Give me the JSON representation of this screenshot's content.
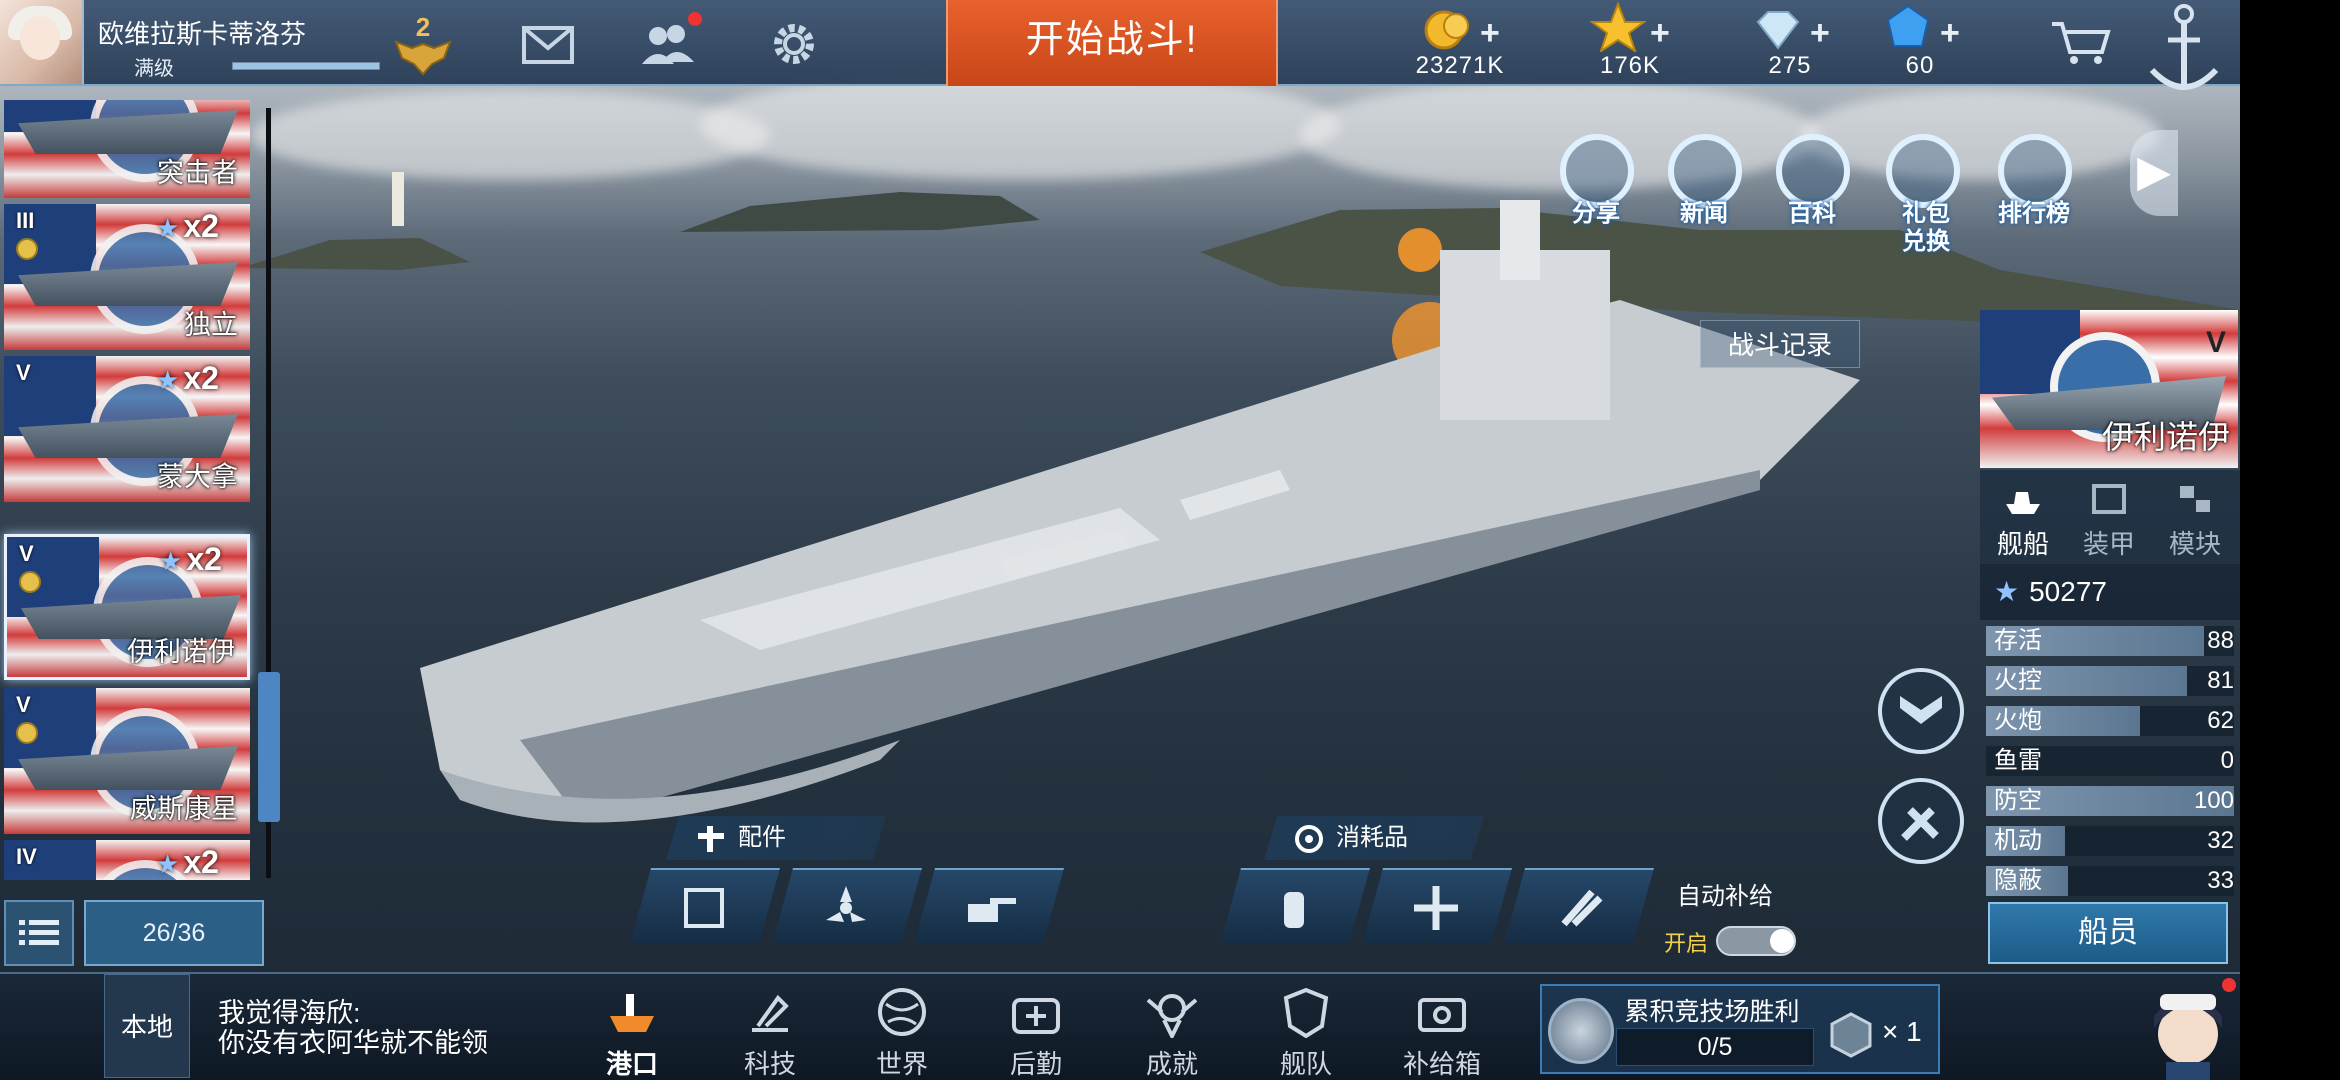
{
  "player": {
    "name": "欧维拉斯卡蒂洛芬",
    "level_label": "满级",
    "xp_fraction": 1.0,
    "rank": "2"
  },
  "top": {
    "start_battle_label": "开始战斗!",
    "resources": [
      {
        "icon": "gold-coin-icon",
        "value": "23271K"
      },
      {
        "icon": "star-icon",
        "value": "176K"
      },
      {
        "icon": "diamond-icon",
        "value": "275"
      },
      {
        "icon": "blue-crystal-icon",
        "value": "60"
      }
    ]
  },
  "quick_menu": [
    {
      "icon": "share-icon",
      "label": "分享"
    },
    {
      "icon": "news-icon",
      "label": "新闻"
    },
    {
      "icon": "encyclopedia-icon",
      "label": "百科"
    },
    {
      "icon": "gift-redeem-icon",
      "label": "礼包兑换"
    },
    {
      "icon": "leaderboard-icon",
      "label": "排行榜"
    }
  ],
  "battle_record_label": "战斗记录",
  "ship_list": [
    {
      "name": "突击者",
      "tier": "",
      "multiplier": ""
    },
    {
      "name": "独立",
      "tier": "III",
      "multiplier": "x2"
    },
    {
      "name": "蒙大拿",
      "tier": "V",
      "multiplier": "x2"
    },
    {
      "name": "伊利诺伊",
      "tier": "V",
      "multiplier": "x2"
    },
    {
      "name": "威斯康星",
      "tier": "V",
      "multiplier": ""
    },
    {
      "name": "",
      "tier": "IV",
      "multiplier": "x2"
    }
  ],
  "ship_count": "26/36",
  "selected_ship": {
    "name": "伊利诺伊",
    "tier": "V",
    "tabs": [
      "舰船",
      "装甲",
      "模块"
    ],
    "power": "50277",
    "stats": [
      {
        "label": "存活",
        "value": 88
      },
      {
        "label": "火控",
        "value": 81
      },
      {
        "label": "火炮",
        "value": 62
      },
      {
        "label": "鱼雷",
        "value": 0
      },
      {
        "label": "防空",
        "value": 100
      },
      {
        "label": "机动",
        "value": 32
      },
      {
        "label": "隐蔽",
        "value": 33
      }
    ],
    "crew_label": "船员"
  },
  "equipment": {
    "parts_label": "配件",
    "consumables_label": "消耗品",
    "auto_supply_label": "自动补给",
    "auto_supply_state": "开启"
  },
  "chat": {
    "channel": "本地",
    "message_line1": "我觉得海欣:",
    "message_line2": "你没有衣阿华就不能领"
  },
  "nav": [
    {
      "icon": "port-icon",
      "label": "港口"
    },
    {
      "icon": "tech-icon",
      "label": "科技"
    },
    {
      "icon": "world-icon",
      "label": "世界"
    },
    {
      "icon": "logistics-icon",
      "label": "后勤"
    },
    {
      "icon": "achievement-icon",
      "label": "成就"
    },
    {
      "icon": "fleet-icon",
      "label": "舰队"
    },
    {
      "icon": "supply-box-icon",
      "label": "补给箱"
    }
  ],
  "arena": {
    "title": "累积竞技场胜利",
    "progress": "0/5",
    "reward_count": "× 1"
  }
}
